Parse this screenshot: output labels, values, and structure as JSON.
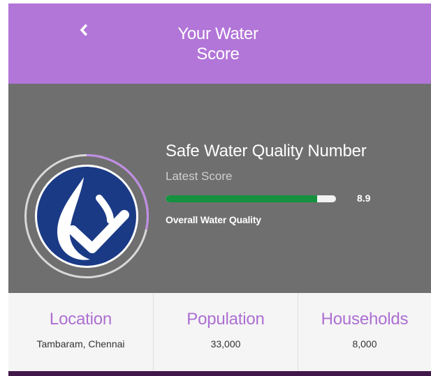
{
  "header": {
    "title_line1": "Your Water",
    "title_line2": "Score",
    "back_icon": "chevron-left-icon",
    "background": "#b275d8"
  },
  "score_card": {
    "icon": "water-drop-check-icon",
    "metric_name": "Safe Water Quality Number",
    "latest_label": "Latest Score",
    "score": "8.9",
    "score_fraction": 0.89,
    "progress_color": "#15913f",
    "quality_label": "Overall Water Quality"
  },
  "stats": [
    {
      "label": "Location",
      "value": "Tambaram, Chennai"
    },
    {
      "label": "Population",
      "value": "33,000"
    },
    {
      "label": "Households",
      "value": "8,000"
    }
  ]
}
